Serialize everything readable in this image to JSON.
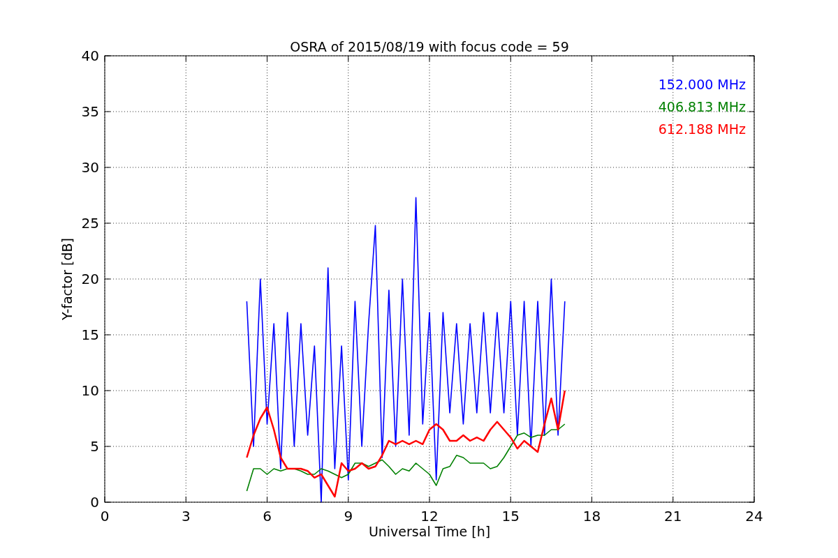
{
  "chart_data": {
    "type": "line",
    "grid": true,
    "title": "OSRA of 2015/08/19 with focus code = 59",
    "xlabel": "Universal Time [h]",
    "ylabel": "Y-factor [dB]",
    "xlim": [
      0,
      24
    ],
    "ylim": [
      0,
      40
    ],
    "xticks": [
      0,
      3,
      6,
      9,
      12,
      15,
      18,
      21,
      24
    ],
    "yticks": [
      0,
      5,
      10,
      15,
      20,
      25,
      30,
      35,
      40
    ],
    "x": [
      5.25,
      5.5,
      5.75,
      6,
      6.25,
      6.5,
      6.75,
      7,
      7.25,
      7.5,
      7.75,
      8,
      8.25,
      8.5,
      8.75,
      9,
      9.25,
      9.5,
      9.75,
      10,
      10.25,
      10.5,
      10.75,
      11,
      11.25,
      11.5,
      11.75,
      12,
      12.25,
      12.5,
      12.75,
      13,
      13.25,
      13.5,
      13.75,
      14,
      14.25,
      14.5,
      14.75,
      15,
      15.25,
      15.5,
      15.75,
      16,
      16.25,
      16.5,
      16.75,
      17
    ],
    "series": [
      {
        "name": "152.000 MHz",
        "color": "#0000ff",
        "values": [
          18,
          5,
          20,
          7,
          16,
          3,
          17,
          5,
          16,
          6,
          14,
          0,
          21,
          3,
          14,
          2,
          18,
          5,
          16,
          24.8,
          4,
          19,
          5,
          20,
          6,
          27.3,
          7,
          17,
          2,
          17,
          8,
          16,
          7,
          16,
          8,
          17,
          8,
          17,
          8,
          18,
          6,
          18,
          5,
          18,
          6,
          20,
          6,
          18
        ]
      },
      {
        "name": "406.813 MHz",
        "color": "#008000",
        "values": [
          1,
          3,
          3,
          2.5,
          3,
          2.8,
          3,
          3,
          2.8,
          2.5,
          2.5,
          3,
          2.8,
          2.5,
          2.2,
          2.5,
          3.5,
          3.5,
          3.2,
          3.5,
          3.8,
          3.2,
          2.5,
          3,
          2.8,
          3.5,
          3,
          2.5,
          1.5,
          3,
          3.2,
          4.2,
          4,
          3.5,
          3.5,
          3.5,
          3,
          3.2,
          4,
          5,
          6,
          6.2,
          5.8,
          6,
          6,
          6.5,
          6.5,
          7
        ]
      },
      {
        "name": "612.188 MHz",
        "color": "#ff0000",
        "values": [
          4,
          6,
          7.5,
          8.5,
          6.5,
          4,
          3,
          3,
          3,
          2.8,
          2.2,
          2.5,
          1.5,
          0.5,
          3.5,
          2.8,
          3,
          3.5,
          3,
          3.2,
          4.2,
          5.5,
          5.2,
          5.5,
          5.2,
          5.5,
          5.2,
          6.5,
          7,
          6.5,
          5.5,
          5.5,
          6,
          5.5,
          5.8,
          5.5,
          6.5,
          7.2,
          6.5,
          5.8,
          4.8,
          5.5,
          5,
          4.5,
          7,
          9.3,
          6.5,
          10
        ]
      }
    ]
  }
}
